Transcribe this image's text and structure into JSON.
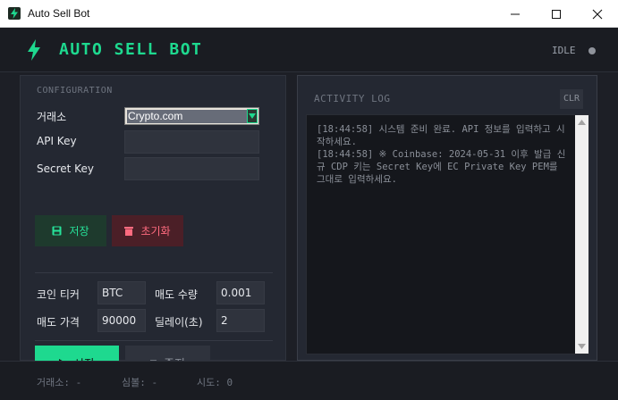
{
  "window": {
    "title": "Auto Sell Bot"
  },
  "header": {
    "title": "AUTO SELL BOT",
    "status": "IDLE"
  },
  "config": {
    "section_title": "CONFIGURATION",
    "exchange_label": "거래소",
    "exchange_value": "Crypto.com",
    "api_key_label": "API Key",
    "api_key_value": "",
    "secret_key_label": "Secret Key",
    "secret_key_value": "",
    "save_label": "저장",
    "reset_label": "초기화"
  },
  "trade": {
    "ticker_label": "코인 티커",
    "ticker_value": "BTC",
    "sell_qty_label": "매도 수량",
    "sell_qty_value": "0.001",
    "sell_price_label": "매도 가격",
    "sell_price_value": "90000",
    "delay_label": "딜레이(초)",
    "delay_value": "2"
  },
  "controls": {
    "start_label": "시작",
    "stop_label": "중지"
  },
  "log": {
    "title": "ACTIVITY LOG",
    "clear_label": "CLR",
    "text": "[18:44:58] 시스템 준비 완료. API 정보를 입력하고 시작하세요.\n[18:44:58] ※ Coinbase: 2024-05-31 이후 발급 신규 CDP 키는 Secret Key에 EC Private Key PEM를 그대로 입력하세요."
  },
  "statusbar": {
    "exchange": "거래소: -",
    "symbol": "심볼: -",
    "attempts": "시도: 0"
  },
  "colors": {
    "accent": "#1ed98f",
    "danger": "#ff6b7f",
    "background": "#1d1f26"
  }
}
